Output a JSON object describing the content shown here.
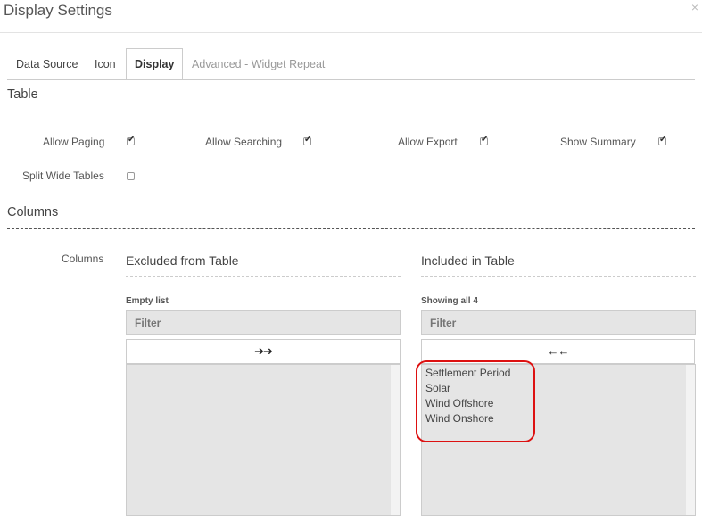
{
  "dialog": {
    "title": "Display Settings",
    "close": "×"
  },
  "tabs": [
    {
      "label": "Data Source"
    },
    {
      "label": "Icon"
    },
    {
      "label": "Display"
    },
    {
      "label": "Advanced - Widget Repeat"
    }
  ],
  "table_section": {
    "title": "Table",
    "options": [
      {
        "label": "Allow Paging",
        "checked": true
      },
      {
        "label": "Allow Searching",
        "checked": true
      },
      {
        "label": "Allow Export",
        "checked": true
      },
      {
        "label": "Show Summary",
        "checked": true
      },
      {
        "label": "Split Wide Tables",
        "checked": false
      }
    ]
  },
  "columns_section": {
    "title": "Columns",
    "field_label": "Columns",
    "excluded": {
      "title": "Excluded from Table",
      "info": "Empty list",
      "filter_placeholder": "Filter",
      "move_button": "➔➔",
      "items": []
    },
    "included": {
      "title": "Included in Table",
      "info": "Showing all 4",
      "filter_placeholder": "Filter",
      "move_button": "🡠🡠",
      "items": [
        "Settlement Period",
        "Solar",
        "Wind Offshore",
        "Wind Onshore"
      ]
    }
  }
}
